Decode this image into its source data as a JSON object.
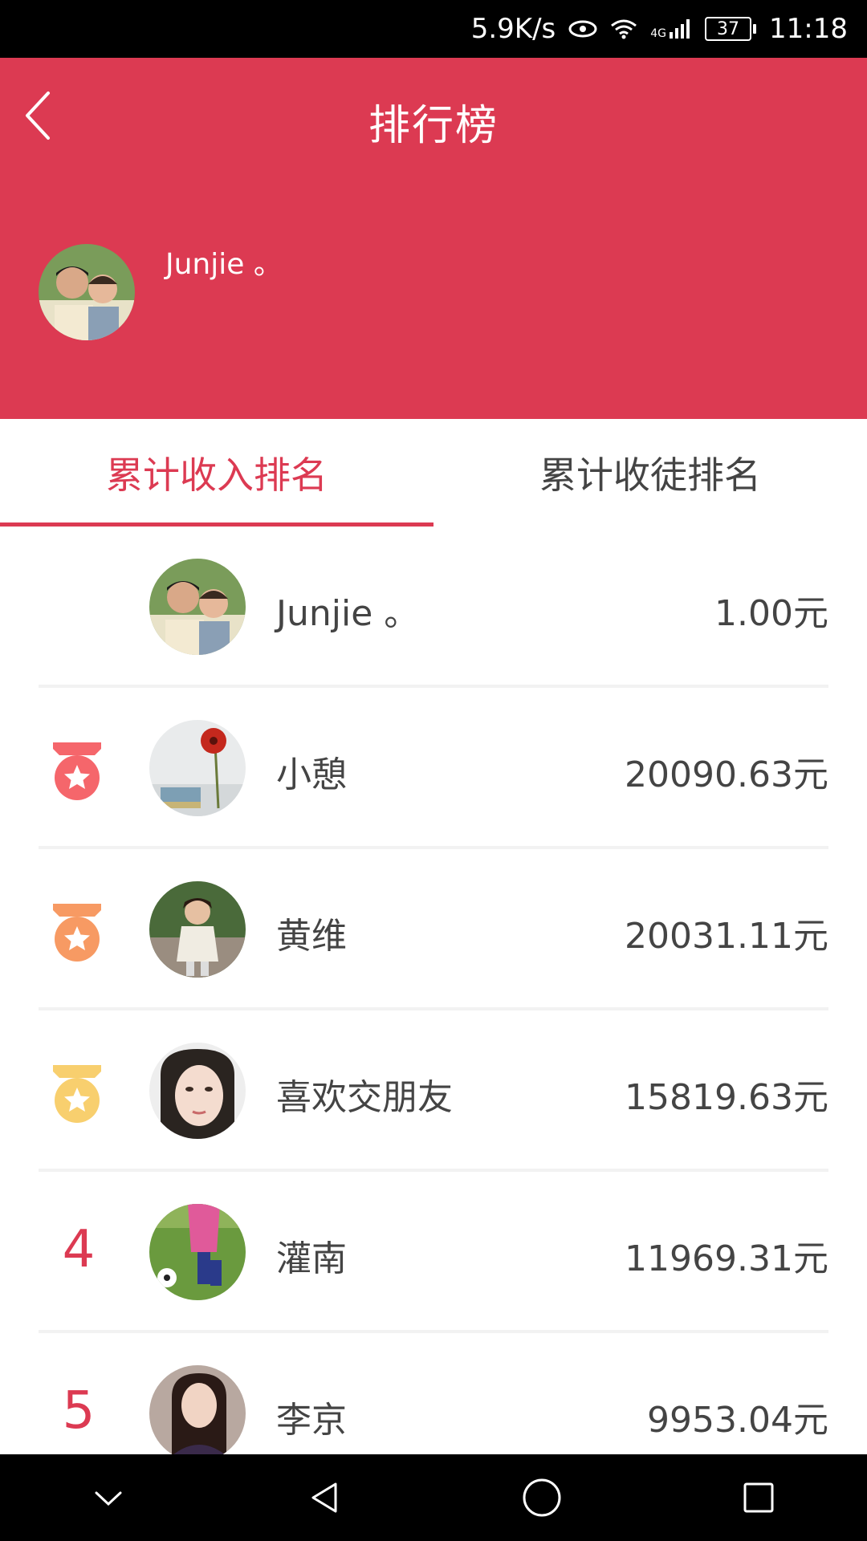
{
  "status_bar": {
    "net_speed": "5.9K/s",
    "network": "4G",
    "battery": "37",
    "time": "11:18"
  },
  "header": {
    "title": "排行榜",
    "user_name": "Junjie 。"
  },
  "tabs": [
    {
      "label": "累计收入排名",
      "active": true
    },
    {
      "label": "累计收徒排名",
      "active": false
    }
  ],
  "ranking": [
    {
      "rank": "",
      "name": "Junjie 。",
      "amount": "1.00元"
    },
    {
      "rank": "1",
      "name": "小憩",
      "amount": "20090.63元"
    },
    {
      "rank": "2",
      "name": "黄维",
      "amount": "20031.11元"
    },
    {
      "rank": "3",
      "name": "喜欢交朋友",
      "amount": "15819.63元"
    },
    {
      "rank": "4",
      "name": "灌南",
      "amount": "11969.31元"
    },
    {
      "rank": "5",
      "name": "李京",
      "amount": "9953.04元"
    }
  ],
  "colors": {
    "accent": "#dc3a52",
    "medal_gold": "#f5666b",
    "medal_silver": "#f79a63",
    "medal_bronze": "#f8cf6e"
  },
  "icons": {
    "back": "chevron-left-icon",
    "nav_down": "chevron-down-icon",
    "nav_back": "triangle-back-icon",
    "nav_home": "circle-home-icon",
    "nav_recent": "square-recent-icon"
  }
}
